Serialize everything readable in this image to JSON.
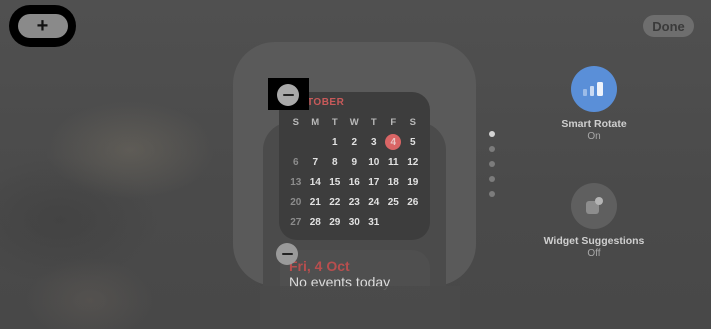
{
  "toolbar": {
    "add_label": "+",
    "done_label": "Done"
  },
  "calendar": {
    "month": "OCTOBER",
    "weekdays": [
      "S",
      "M",
      "T",
      "W",
      "T",
      "F",
      "S"
    ],
    "weeks": [
      [
        "",
        "",
        "1",
        "2",
        "3",
        "4",
        "5"
      ],
      [
        "6",
        "7",
        "8",
        "9",
        "10",
        "11",
        "12"
      ],
      [
        "13",
        "14",
        "15",
        "16",
        "17",
        "18",
        "19"
      ],
      [
        "20",
        "21",
        "22",
        "23",
        "24",
        "25",
        "26"
      ],
      [
        "27",
        "28",
        "29",
        "30",
        "31",
        "",
        ""
      ]
    ],
    "today": "4",
    "accent_color": "#d96565"
  },
  "next_widget": {
    "date": "Fri, 4 Oct",
    "events": "No events today"
  },
  "page_dots": {
    "count": 5,
    "active_index": 0
  },
  "options": {
    "smart_rotate": {
      "title": "Smart Rotate",
      "value": "On",
      "icon": "stack-rotate-icon",
      "color": "#5a8fd8"
    },
    "widget_suggestions": {
      "title": "Widget Suggestions",
      "value": "Off",
      "icon": "widget-suggestions-icon"
    }
  }
}
